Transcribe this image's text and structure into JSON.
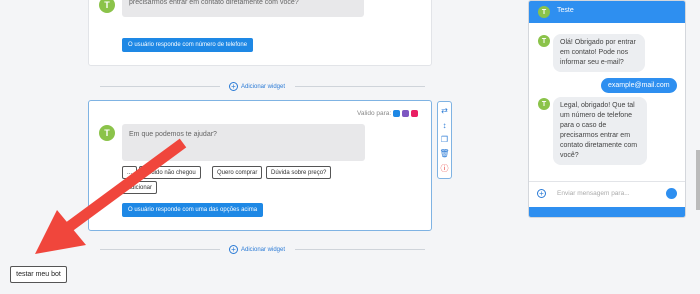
{
  "canvas": {
    "top_card": {
      "avatar": "T",
      "bubble_text": "Legal, obrigado! Que tal um número de telefone para o caso de precisarmos entrar em contato diretamente com você?",
      "action_button": "O usuário responde com número de telefone"
    },
    "add_widget_label": "Adicionar widget",
    "mid_card": {
      "valid_for_label": "Valido para:",
      "channels": [
        {
          "icon": "messenger-icon",
          "color": "#1e88e5"
        },
        {
          "icon": "chat-icon",
          "color": "#7e57c2"
        },
        {
          "icon": "instagram-icon",
          "color": "#e91e63"
        }
      ],
      "avatar": "T",
      "bubble_text": "Em que podemos te ajudar?",
      "options": [
        "...",
        "Pedido não chegou",
        "Quero comprar",
        "Dúvida sobre preço?",
        "Adicionar"
      ],
      "action_button": "O usuário responde com uma das opções acima"
    },
    "toolbar": [
      "shuffle-icon",
      "move-icon",
      "copy-icon",
      "delete-icon",
      "alert-icon"
    ],
    "test_button": "testar meu bot"
  },
  "chat": {
    "header_avatar": "T",
    "header_title": "Teste",
    "messages": [
      {
        "from": "bot",
        "text": "Olá! Obrigado por entrar em contato! Pode nos informar seu e-mail?"
      },
      {
        "from": "user",
        "text": "example@mail.com"
      },
      {
        "from": "bot",
        "text": "Legal, obrigado! Que tal um número de telefone para o caso de precisarmos entrar em contato diretamente com você?"
      }
    ],
    "input_placeholder": "Enviar mensagem para...",
    "add_icon": "plus-icon",
    "emoji_icon": "emoji-icon"
  },
  "colors": {
    "accent": "#2e8ff0",
    "arrow": "#f0463c",
    "avatar": "#8bc34a"
  }
}
